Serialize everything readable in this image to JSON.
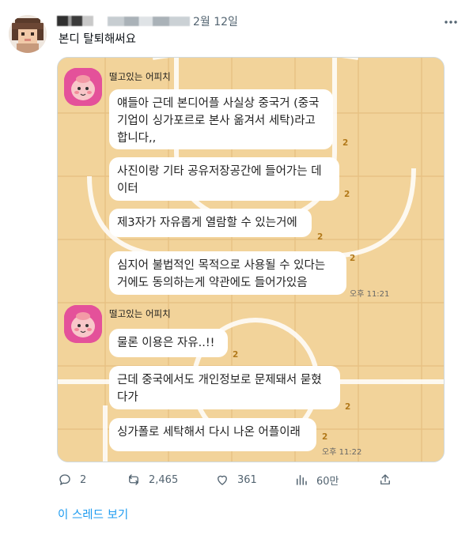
{
  "tweet": {
    "date": "2월 12일",
    "text": "본디 탈퇴해써요"
  },
  "chat": {
    "sender_name": "떨고있는 어피치",
    "group1": {
      "messages": [
        {
          "text": "얘들아 근데 본디어플 사실상 중국거 (중국\n기업이 싱가포르로 본사 옮겨서 세탁)라고\n합니다,,",
          "unread": "2"
        },
        {
          "text": "사진이랑 기타 공유저장공간에 들어가는 데\n이터",
          "unread": "2"
        },
        {
          "text": "제3자가 자유롭게 열람할 수 있는거에",
          "unread": "2"
        },
        {
          "text": "심지어 불법적인 목적으로 사용될 수 있다는\n거에도 동의하는게 약관에도 들어가있음",
          "unread": "2"
        }
      ],
      "time": "오후 11:21"
    },
    "group2": {
      "messages": [
        {
          "text": "물론 이용은 자유..!!",
          "unread": "2"
        },
        {
          "text": "근데 중국에서도 개인정보로 문제돼서 묻혔\n다가",
          "unread": "2"
        },
        {
          "text": "싱가폴로 세탁해서 다시 나온 어플이래",
          "unread": "2"
        }
      ],
      "time": "오후 11:22"
    },
    "colors": {
      "background": "#f2d39a",
      "bubble": "#ffffff",
      "avatar_bg": "#e4519a"
    }
  },
  "actions": {
    "reply_count": "2",
    "retweet_count": "2,465",
    "like_count": "361",
    "view_count": "60만",
    "icons": [
      "reply-icon",
      "retweet-icon",
      "like-icon",
      "views-icon",
      "share-icon"
    ]
  },
  "thread_link": "이 스레드 보기"
}
